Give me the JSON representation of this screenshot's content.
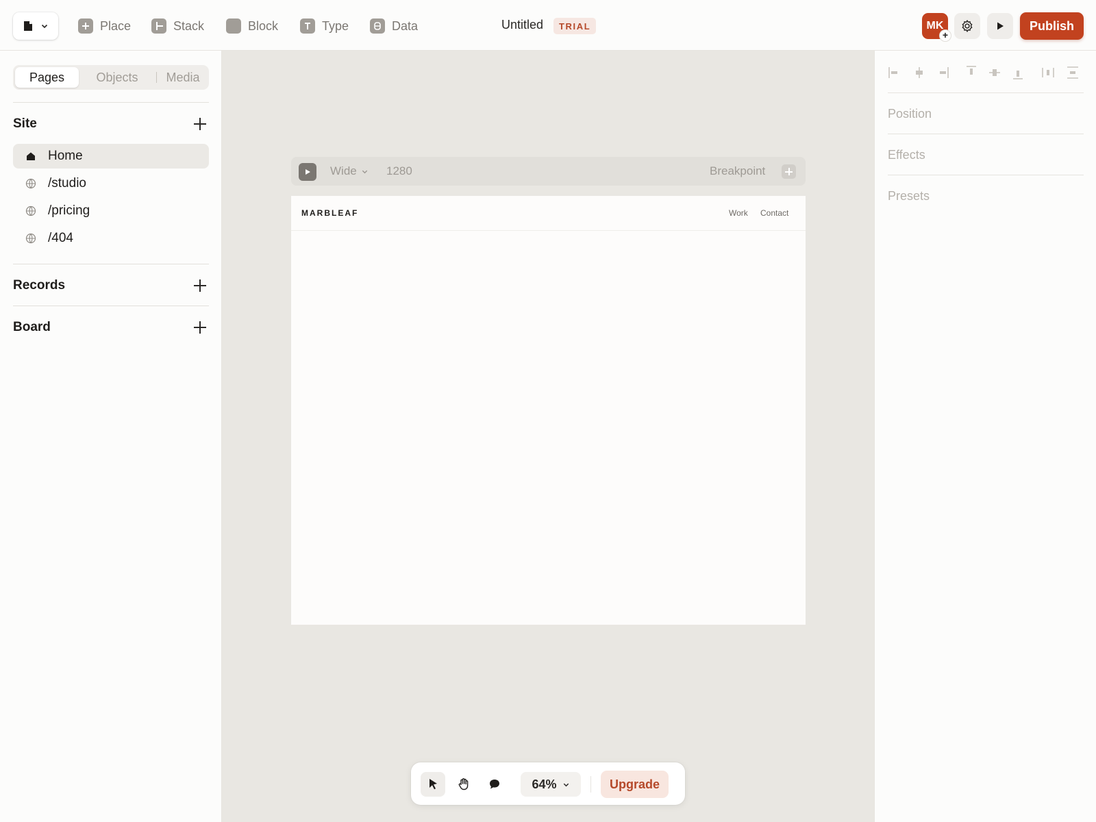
{
  "topbar": {
    "tools": [
      {
        "label": "Place",
        "icon": "plus-square-icon"
      },
      {
        "label": "Stack",
        "icon": "stack-icon"
      },
      {
        "label": "Block",
        "icon": "block-icon"
      },
      {
        "label": "Type",
        "icon": "text-icon"
      },
      {
        "label": "Data",
        "icon": "database-icon"
      }
    ],
    "title": "Untitled",
    "badge": "TRIAL",
    "avatar_initials": "MK",
    "publish_label": "Publish"
  },
  "sidebar": {
    "tabs": [
      "Pages",
      "Objects",
      "Media"
    ],
    "active_tab": "Pages",
    "site_heading": "Site",
    "pages": [
      {
        "label": "Home",
        "icon": "home-icon",
        "active": true
      },
      {
        "label": "/studio",
        "icon": "globe-icon"
      },
      {
        "label": "/pricing",
        "icon": "globe-icon"
      },
      {
        "label": "/404",
        "icon": "globe-icon"
      }
    ],
    "records_heading": "Records",
    "board_heading": "Board"
  },
  "canvas": {
    "breakpoint": {
      "name": "Wide",
      "width": "1280",
      "label": "Breakpoint"
    },
    "frame": {
      "brand": "MARBLEAF",
      "nav": [
        "Work",
        "Contact"
      ]
    }
  },
  "bottombar": {
    "zoom": "64%",
    "upgrade_label": "Upgrade"
  },
  "right_panel": {
    "sections": [
      "Position",
      "Effects",
      "Presets"
    ]
  },
  "colors": {
    "accent": "#c2421f",
    "canvas_bg": "#e9e7e2",
    "panel_bg": "#fcfcfb"
  }
}
